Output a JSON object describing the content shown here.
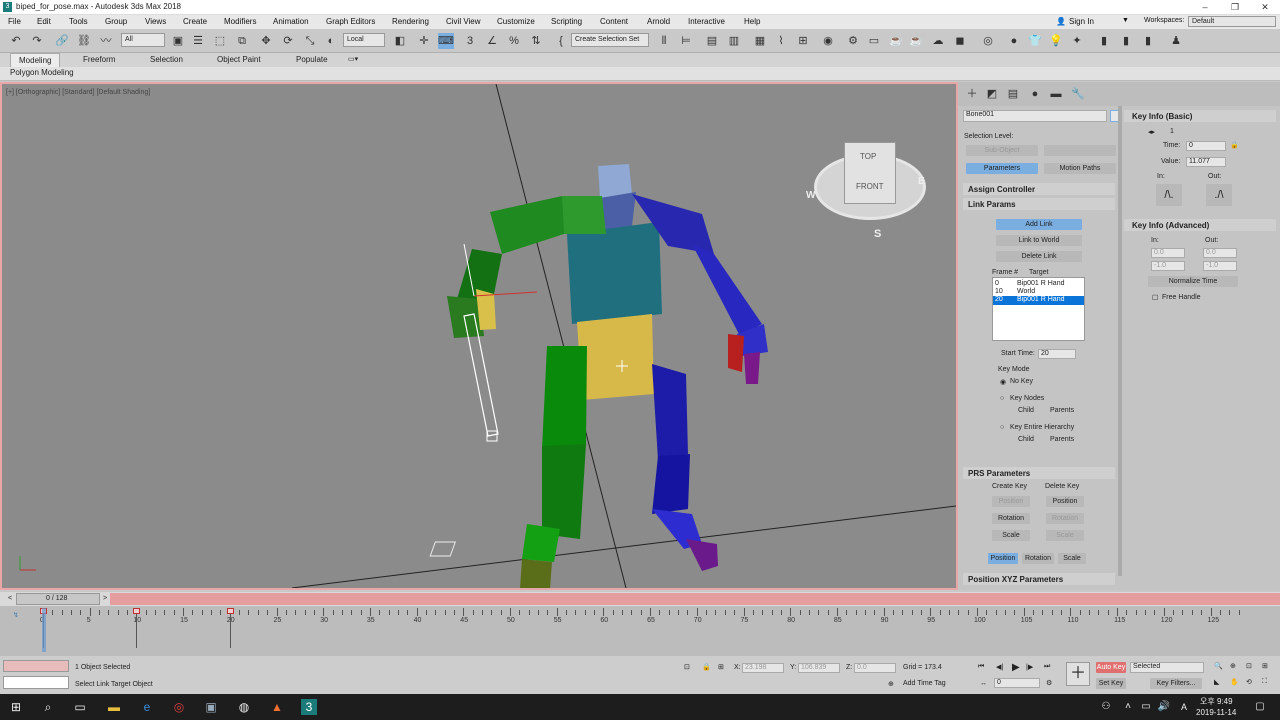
{
  "window": {
    "title": "biped_for_pose.max - Autodesk 3ds Max 2018"
  },
  "menu": [
    "File",
    "Edit",
    "Tools",
    "Group",
    "Views",
    "Create",
    "Modifiers",
    "Animation",
    "Graph Editors",
    "Rendering",
    "Civil View",
    "Customize",
    "Scripting",
    "Content",
    "Arnold",
    "Interactive",
    "Help"
  ],
  "account": {
    "signin": "Sign In",
    "workspaces_label": "Workspaces:",
    "workspaces_value": "Default"
  },
  "toolbar": {
    "filter": "All",
    "coord": "Local",
    "selection_set": "Create Selection Set"
  },
  "ribbon": {
    "tabs": [
      "Modeling",
      "Freeform",
      "Selection",
      "Object Paint",
      "Populate"
    ],
    "sub": "Polygon Modeling"
  },
  "viewport": {
    "label": "[+] [Orthographic] [Standard] [Default Shading]",
    "cube": {
      "top": "TOP",
      "front": "FRONT",
      "w": "W",
      "e": "E",
      "s": "S"
    }
  },
  "panel": {
    "object_name": "Bone001",
    "selection_level": "Selection Level:",
    "sub_object": "Sub-Object",
    "parameters": "Parameters",
    "motion_paths": "Motion Paths",
    "assign_controller": "Assign Controller",
    "link_params": "Link Params",
    "add_link": "Add Link",
    "link_to_world": "Link to World",
    "delete_link": "Delete Link",
    "frame_col": "Frame #",
    "target_col": "Target",
    "links": [
      {
        "frame": "0",
        "target": "Bip001 R Hand"
      },
      {
        "frame": "10",
        "target": "World"
      },
      {
        "frame": "20",
        "target": "Bip001 R Hand"
      }
    ],
    "start_time_label": "Start Time:",
    "start_time": "20",
    "key_mode": "Key Mode",
    "no_key": "No Key",
    "key_nodes": "Key Nodes",
    "key_entire": "Key Entire Hierarchy",
    "child": "Child",
    "parents": "Parents",
    "prs": "PRS Parameters",
    "create_key": "Create Key",
    "delete_key": "Delete Key",
    "position": "Position",
    "rotation": "Rotation",
    "scale": "Scale",
    "pos_xyz": "Position XYZ Parameters"
  },
  "keyinfo": {
    "basic": "Key Info (Basic)",
    "key_index": "1",
    "time_label": "Time:",
    "time": "0",
    "value_label": "Value:",
    "value": "11.077",
    "in": "In:",
    "out": "Out:",
    "advanced": "Key Info (Advanced)",
    "adv_in": "0.0",
    "adv_out": "0.0",
    "adv_in2": "-1.0",
    "adv_out2": "-1.0",
    "normalize": "Normalize Time",
    "free_handle": "Free Handle"
  },
  "timeline": {
    "counter": "0 / 128",
    "ticks": [
      "0",
      "5",
      "10",
      "15",
      "20",
      "25",
      "30",
      "35",
      "40",
      "45",
      "50",
      "55",
      "60",
      "65",
      "70",
      "75",
      "80",
      "85",
      "90",
      "95",
      "100",
      "105",
      "110",
      "115",
      "120",
      "125"
    ],
    "keys": [
      "0",
      "10",
      "20"
    ]
  },
  "status": {
    "selected": "1 Object Selected",
    "prompt": "Select Link Target Object",
    "x_label": "X:",
    "x": "23.198",
    "y_label": "Y:",
    "y": "106.839",
    "z_label": "Z:",
    "z": "0.0",
    "grid": "Grid = 173.4",
    "add_time_tag": "Add Time Tag",
    "frame": "0",
    "autokey": "Auto Key",
    "setkey": "Set Key",
    "selected_dd": "Selected",
    "key_filters": "Key Filters..."
  },
  "taskbar": {
    "time": "오후 9:49",
    "date": "2019-11-14"
  },
  "colors": {
    "viewport_border": "#e9a6a6",
    "accent_blue": "#7aaee0",
    "autokey": "#e07070",
    "timeslider": "#e59da0"
  }
}
